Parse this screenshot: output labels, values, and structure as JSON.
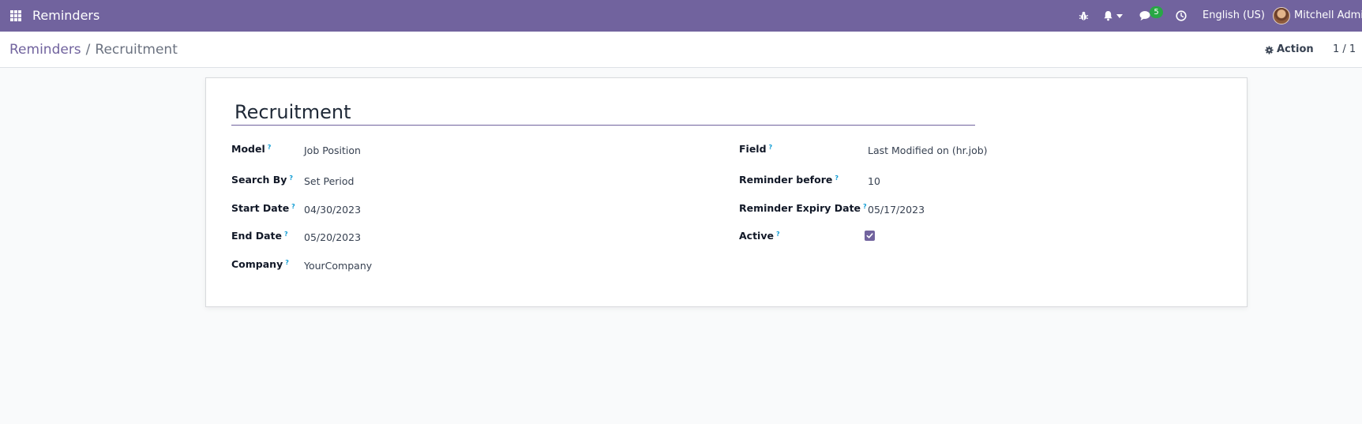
{
  "navbar": {
    "app_title": "Reminders",
    "message_count": "5",
    "language": "English (US)",
    "user_name": "Mitchell Admin",
    "brand_color": "#71639e"
  },
  "control_panel": {
    "breadcrumb_parent": "Reminders",
    "breadcrumb_separator": "/",
    "breadcrumb_current": "Recruitment",
    "action_label": "Action",
    "pager": "1 / 1"
  },
  "form": {
    "name": "Recruitment",
    "help_marker": "?",
    "left": [
      {
        "label": "Model",
        "value": "Job Position"
      },
      {
        "label": "Search By",
        "value": "Set Period"
      },
      {
        "label": "Start Date",
        "value": "04/30/2023"
      },
      {
        "label": "End Date",
        "value": "05/20/2023"
      },
      {
        "label": "Company",
        "value": "YourCompany"
      }
    ],
    "right": [
      {
        "label": "Field",
        "value": "Last Modified on (hr.job)"
      },
      {
        "label": "Reminder before",
        "value": "10"
      },
      {
        "label": "Reminder Expiry Date",
        "value": "05/17/2023"
      },
      {
        "label": "Active",
        "checked": true
      }
    ]
  },
  "icons": [
    "apps-grid-icon",
    "bug-icon",
    "bell-icon",
    "chat-icon",
    "clock-icon",
    "gear-icon",
    "checkmark-icon"
  ]
}
